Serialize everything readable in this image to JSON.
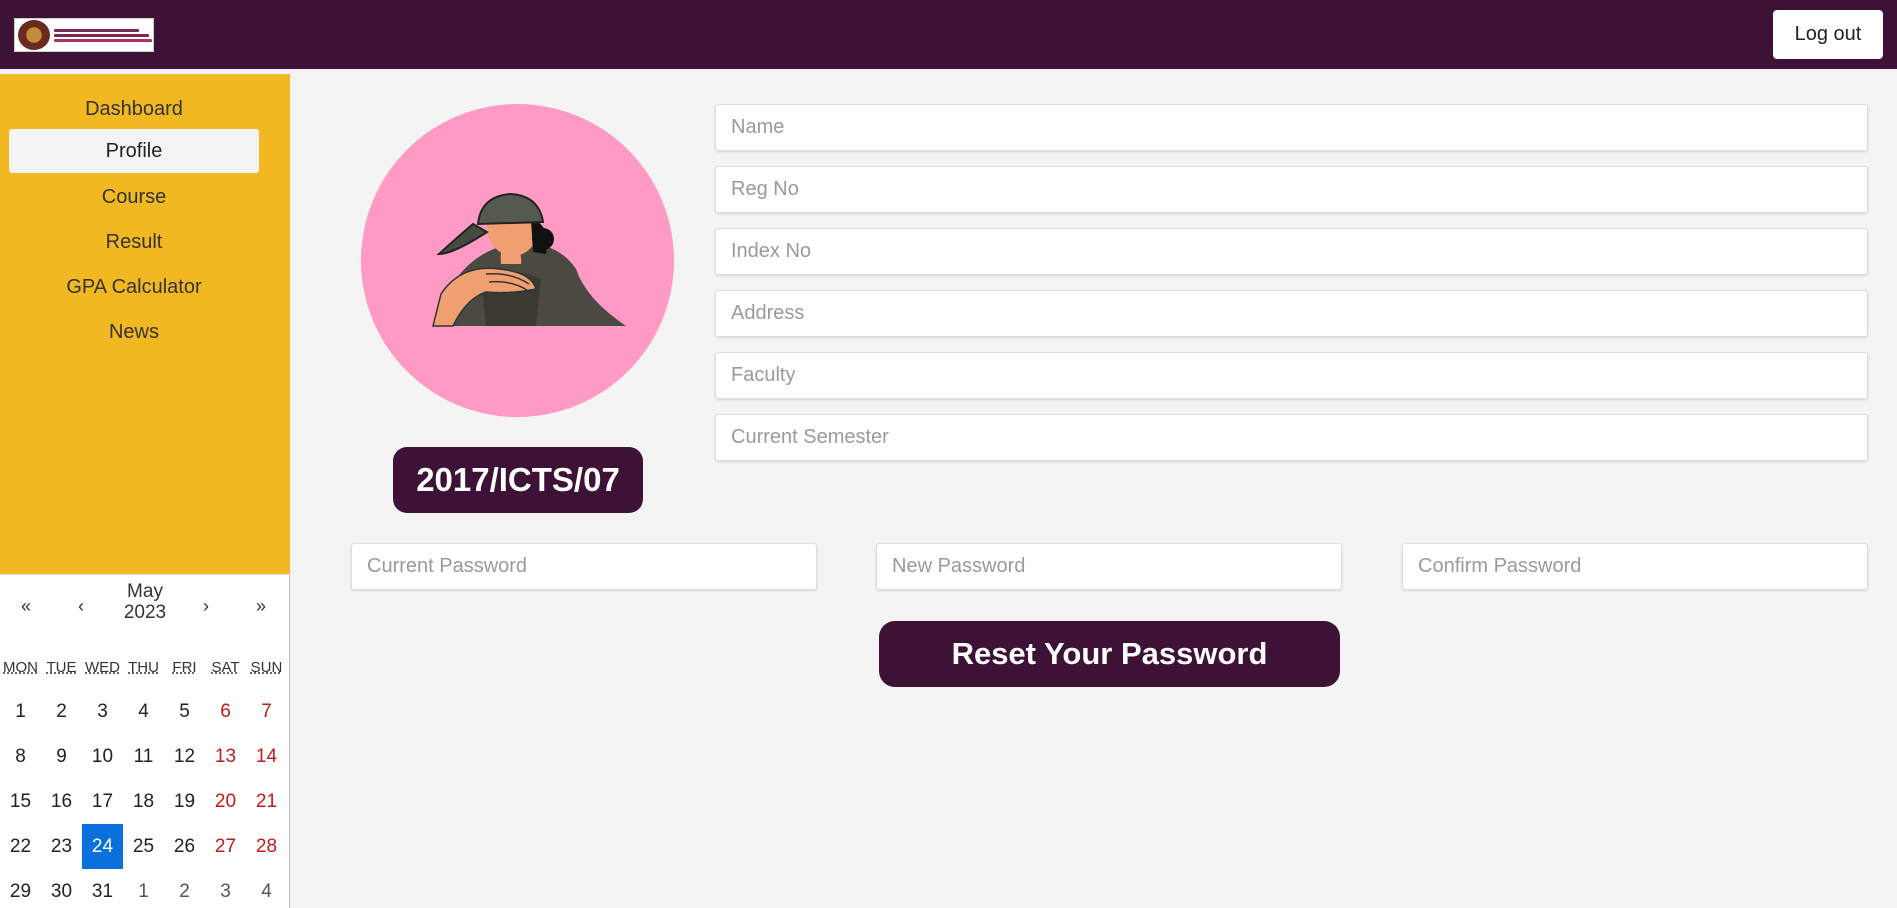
{
  "header": {
    "logo_alt": "University logo",
    "logout_label": "Log out"
  },
  "sidebar": {
    "items": [
      {
        "label": "Dashboard",
        "active": false
      },
      {
        "label": "Profile",
        "active": true
      },
      {
        "label": "Course",
        "active": false
      },
      {
        "label": "Result",
        "active": false
      },
      {
        "label": "GPA Calculator",
        "active": false
      },
      {
        "label": "News",
        "active": false
      }
    ]
  },
  "calendar": {
    "nav": {
      "first": "«",
      "prev": "‹",
      "next": "›",
      "last": "»"
    },
    "month": "May",
    "year": "2023",
    "weekdays": [
      "MON",
      "TUE",
      "WED",
      "THU",
      "FRI",
      "SAT",
      "SUN"
    ],
    "weeks": [
      [
        "1",
        "2",
        "3",
        "4",
        "5",
        "6",
        "7"
      ],
      [
        "8",
        "9",
        "10",
        "11",
        "12",
        "13",
        "14"
      ],
      [
        "15",
        "16",
        "17",
        "18",
        "19",
        "20",
        "21"
      ],
      [
        "22",
        "23",
        "24",
        "25",
        "26",
        "27",
        "28"
      ],
      [
        "29",
        "30",
        "31",
        "1",
        "2",
        "3",
        "4"
      ]
    ],
    "today": "24"
  },
  "profile": {
    "reg_no_badge": "2017/ICTS/07",
    "fields": {
      "name": {
        "placeholder": "Name",
        "value": ""
      },
      "reg_no": {
        "placeholder": "Reg No",
        "value": ""
      },
      "index_no": {
        "placeholder": "Index No",
        "value": ""
      },
      "address": {
        "placeholder": "Address",
        "value": ""
      },
      "faculty": {
        "placeholder": "Faculty",
        "value": ""
      },
      "current_semester": {
        "placeholder": "Current Semester",
        "value": ""
      }
    }
  },
  "password": {
    "current": {
      "placeholder": "Current Password",
      "value": ""
    },
    "new": {
      "placeholder": "New Password",
      "value": ""
    },
    "confirm": {
      "placeholder": "Confirm Password",
      "value": ""
    },
    "reset_label": "Reset Your Password"
  },
  "colors": {
    "brand": "#3d1236",
    "sidebar": "#f2b822",
    "avatar_bg": "#fe9ac3",
    "today": "#0a70dc",
    "weekend": "#c11a1a"
  }
}
